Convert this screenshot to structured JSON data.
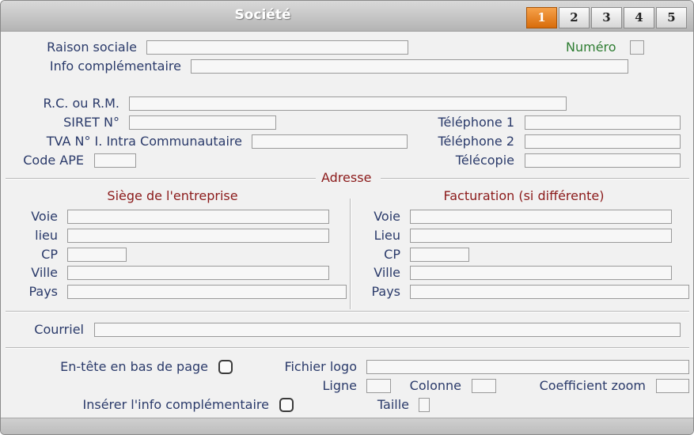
{
  "window": {
    "title": "Société"
  },
  "tabs": [
    "1",
    "2",
    "3",
    "4",
    "5"
  ],
  "active_tab": "1",
  "colors": {
    "active_tab": "#e07a12",
    "label": "#2a3a6a",
    "section_title": "#8b1a1a",
    "numero_label": "#2e7d32"
  },
  "company": {
    "raison_sociale_label": "Raison sociale",
    "numero_label": "Numéro",
    "info_comp_label": "Info complémentaire",
    "rc_rm_label": "R.C. ou R.M.",
    "siret_label": "SIRET N°",
    "tva_label": "TVA N° I. Intra Communautaire",
    "code_ape_label": "Code APE",
    "telephone1_label": "Téléphone 1",
    "telephone2_label": "Téléphone 2",
    "telecopie_label": "Télécopie"
  },
  "address": {
    "section_label": "Adresse",
    "siege": {
      "title": "Siège de l'entreprise",
      "voie": "Voie",
      "lieu": "lieu",
      "cp": "CP",
      "ville": "Ville",
      "pays": "Pays"
    },
    "facturation": {
      "title": "Facturation (si différente)",
      "voie": "Voie",
      "lieu": "Lieu",
      "cp": "CP",
      "ville": "Ville",
      "pays": "Pays"
    }
  },
  "courriel_label": "Courriel",
  "options": {
    "entete_label": "En-tête en bas de page",
    "fichier_logo_label": "Fichier logo",
    "ligne_label": "Ligne",
    "colonne_label": "Colonne",
    "coef_zoom_label": "Coefficient zoom",
    "inserer_info_label": "Insérer l'info complémentaire",
    "taille_label": "Taille"
  }
}
